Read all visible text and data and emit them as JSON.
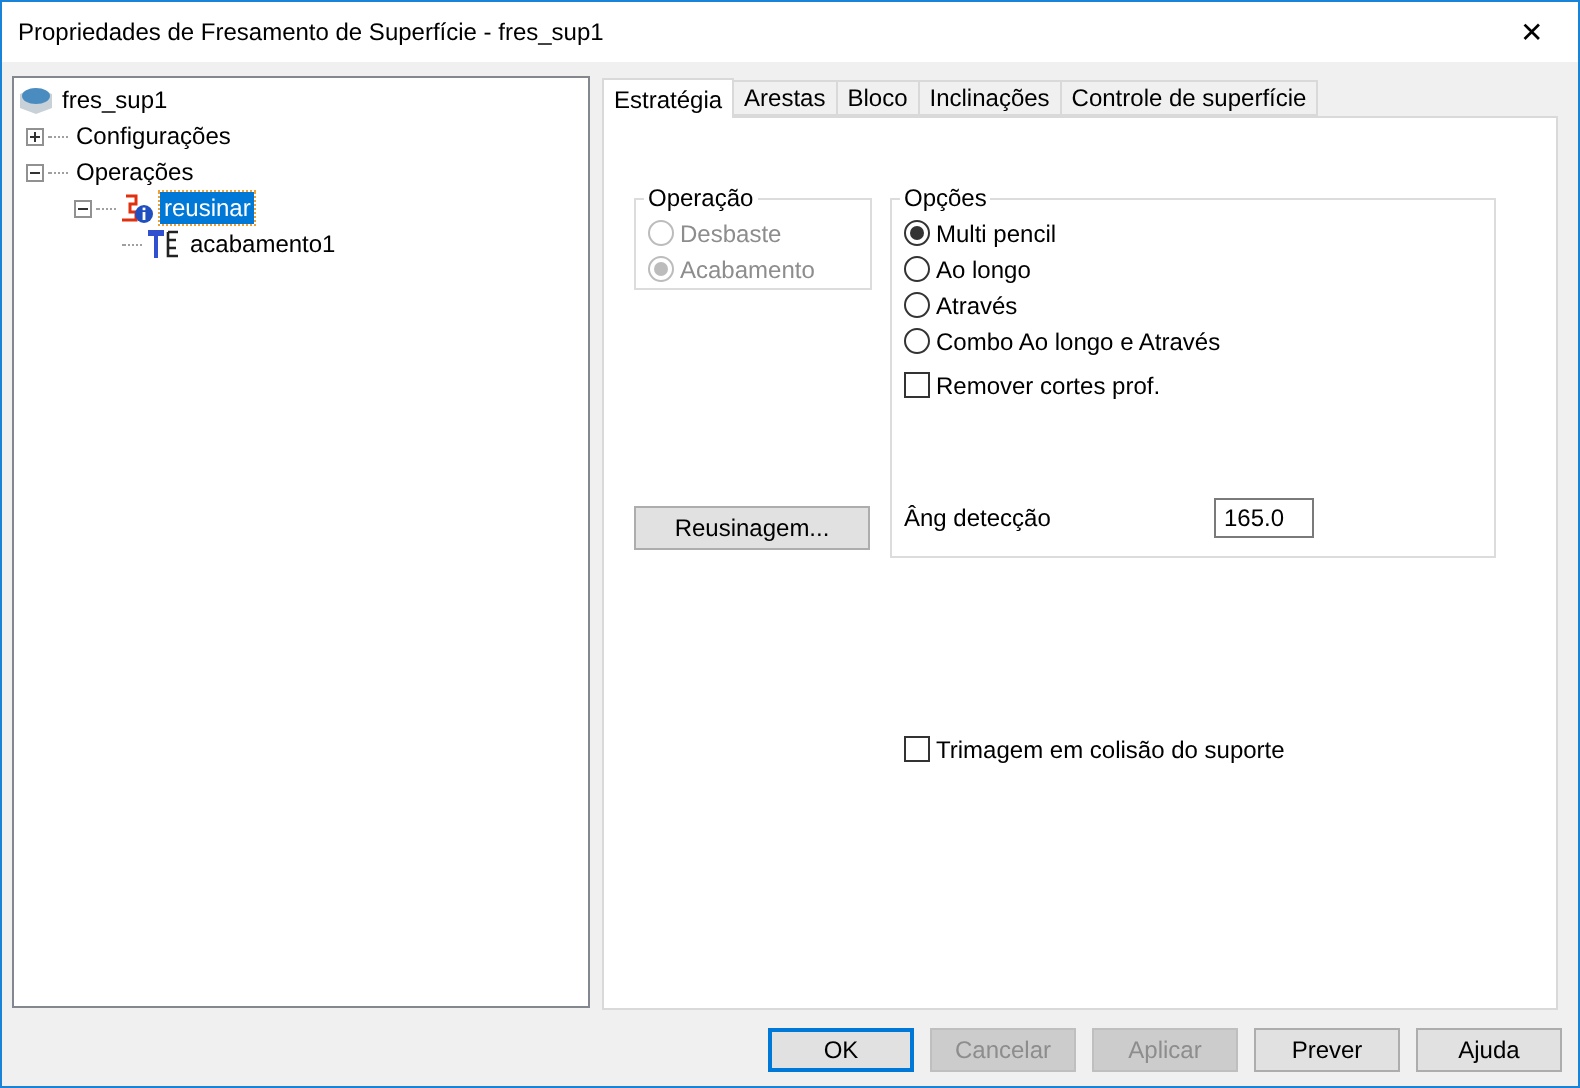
{
  "window": {
    "title": "Propriedades de Fresamento de Superfície - fres_sup1",
    "close": "✕"
  },
  "tree": [
    {
      "label": "fres_sup1",
      "kind": "stock",
      "selected": false,
      "children": [
        {
          "label": "Configurações",
          "expanded": false,
          "selected": false
        },
        {
          "label": "Operações",
          "expanded": true,
          "selected": false,
          "children": [
            {
              "label": "reusinar",
              "kind": "rest",
              "expanded": true,
              "selected": true,
              "children": [
                {
                  "label": "acabamento1",
                  "kind": "finish",
                  "selected": false
                }
              ]
            }
          ]
        }
      ]
    }
  ],
  "tabs": [
    {
      "label": "Estratégia",
      "selected": true
    },
    {
      "label": "Arestas",
      "selected": false
    },
    {
      "label": "Bloco",
      "selected": false
    },
    {
      "label": "Inclinações",
      "selected": false
    },
    {
      "label": "Controle de superfície",
      "selected": false
    }
  ],
  "operation_group": {
    "title": "Operação",
    "options": [
      {
        "label": "Desbaste",
        "selected": false,
        "disabled": true
      },
      {
        "label": "Acabamento",
        "selected": true,
        "disabled": true
      }
    ]
  },
  "rest_button": {
    "label": "Reusinagem...",
    "disabled": false
  },
  "options_group": {
    "title": "Opções",
    "radios": [
      {
        "label": "Multi pencil",
        "selected": true
      },
      {
        "label": "Ao longo",
        "selected": false
      },
      {
        "label": "Através",
        "selected": false
      },
      {
        "label": "Combo Ao longo e Através",
        "selected": false
      }
    ],
    "remove_deep_cuts": {
      "label": "Remover cortes prof.",
      "checked": false
    },
    "angle": {
      "label": "Âng detecção",
      "value": "165.0"
    }
  },
  "trim_check": {
    "label": "Trimagem em colisão do suporte",
    "checked": false
  },
  "buttons": [
    {
      "label": "OK",
      "default": true,
      "disabled": false
    },
    {
      "label": "Cancelar",
      "default": false,
      "disabled": true
    },
    {
      "label": "Aplicar",
      "default": false,
      "disabled": true
    },
    {
      "label": "Prever",
      "default": false,
      "disabled": false
    },
    {
      "label": "Ajuda",
      "default": false,
      "disabled": false
    }
  ]
}
